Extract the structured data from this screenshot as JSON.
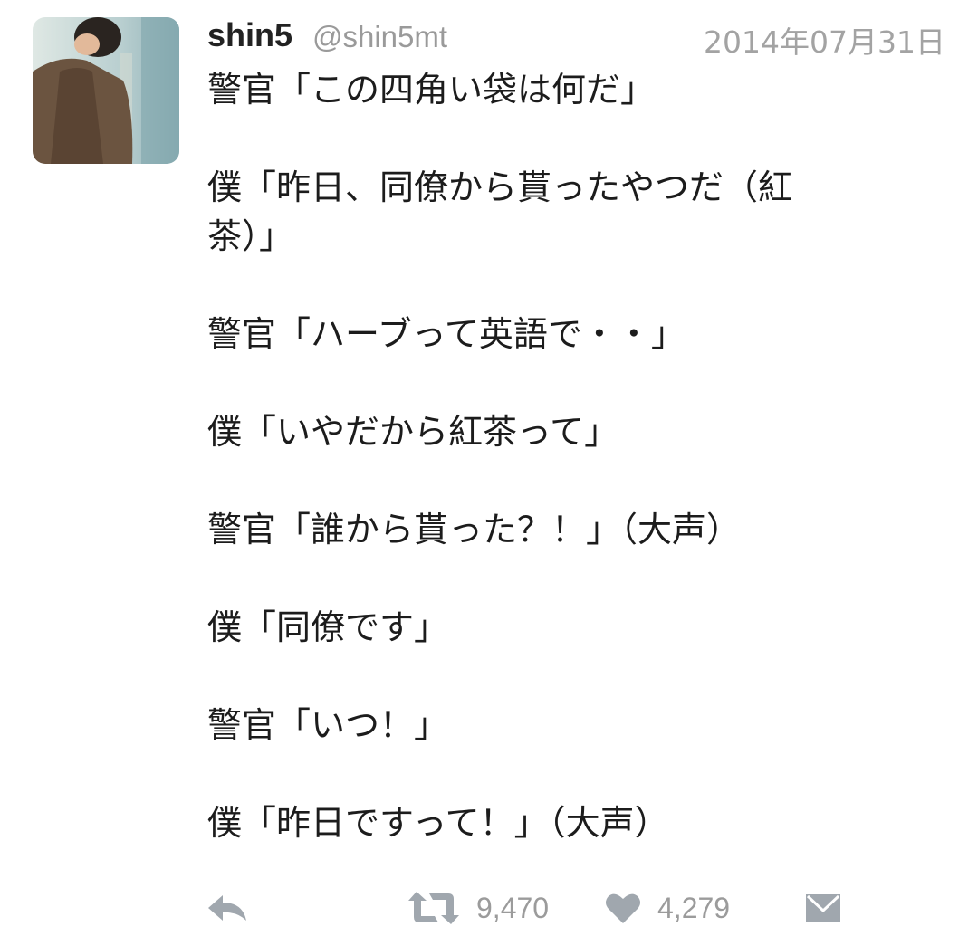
{
  "tweet": {
    "display_name": "shin5",
    "handle": "@shin5mt",
    "timestamp": "2014年07月31日",
    "lines": [
      "警官「この四角い袋は何だ」",
      "",
      "僕「昨日、同僚から貰ったやつだ（紅",
      "茶）」",
      "",
      "警官「ハーブって英語で・・」",
      "",
      "僕「いやだから紅茶って」",
      "",
      "警官「誰から貰った？！」（大声）",
      "",
      "僕「同僚です」",
      "",
      "警官「いつ！」",
      "",
      "僕「昨日ですって！」（大声）"
    ]
  },
  "actions": {
    "reply_icon": "reply-icon",
    "retweet_icon": "retweet-icon",
    "retweet_count": "9,470",
    "like_icon": "heart-icon",
    "like_count": "4,279",
    "dm_icon": "envelope-icon"
  },
  "colors": {
    "text": "#1c1c1c",
    "meta": "#9b9b9b",
    "icon": "#a0a7ae"
  }
}
